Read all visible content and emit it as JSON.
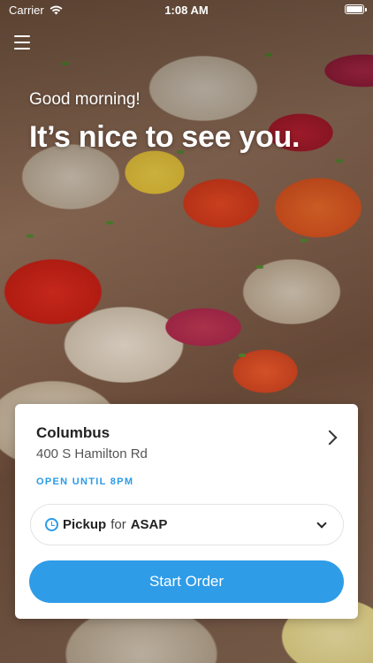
{
  "status_bar": {
    "carrier": "Carrier",
    "time": "1:08 AM"
  },
  "greeting": {
    "subtitle": "Good morning!",
    "headline": "It’s nice to see you."
  },
  "location": {
    "name": "Columbus",
    "address": "400 S Hamilton Rd",
    "hours": "OPEN UNTIL 8PM"
  },
  "order_mode": {
    "mode": "Pickup",
    "connector": "for",
    "time": "ASAP"
  },
  "actions": {
    "start_order": "Start Order"
  },
  "colors": {
    "accent": "#2f9ce8"
  }
}
